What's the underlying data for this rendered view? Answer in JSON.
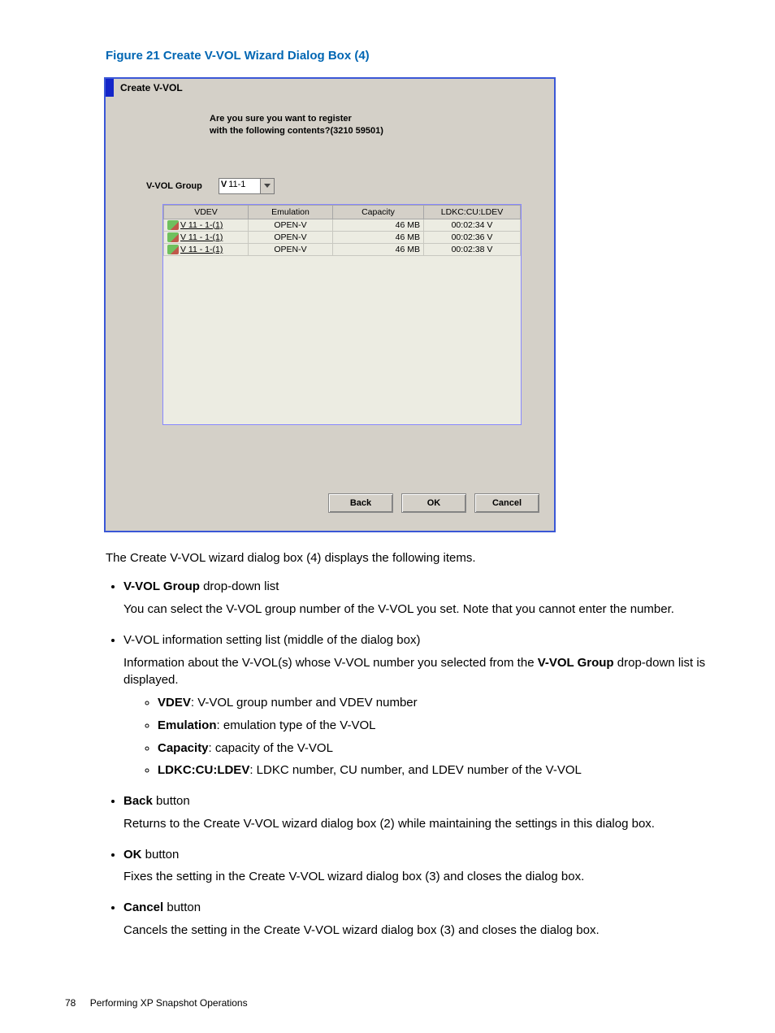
{
  "figure_caption": "Figure 21 Create V-VOL Wizard Dialog Box (4)",
  "dialog": {
    "title": "Create V-VOL",
    "prompt_line1": "Are you sure you want to register",
    "prompt_line2": "with the following contents?(3210 59501)",
    "group_label": "V-VOL Group",
    "group_prefix": "V",
    "group_value": "11-1",
    "table": {
      "headers": [
        "VDEV",
        "Emulation",
        "Capacity",
        "LDKC:CU:LDEV"
      ],
      "rows": [
        {
          "vdev": "V 11 - 1-(1)",
          "emulation": "OPEN-V",
          "capacity": "46 MB",
          "ldev": "00:02:34 V"
        },
        {
          "vdev": "V 11 - 1-(1)",
          "emulation": "OPEN-V",
          "capacity": "46 MB",
          "ldev": "00:02:36 V"
        },
        {
          "vdev": "V 11 - 1-(1)",
          "emulation": "OPEN-V",
          "capacity": "46 MB",
          "ldev": "00:02:38 V"
        }
      ]
    },
    "buttons": {
      "back": "Back",
      "ok": "OK",
      "cancel": "Cancel"
    }
  },
  "intro": "The Create V-VOL wizard dialog box (4) displays the following items.",
  "bullets": {
    "b1_head_bold": "V-VOL Group",
    "b1_head_rest": " drop-down list",
    "b1_body": "You can select the V-VOL group number of the V-VOL you set. Note that you cannot enter the number.",
    "b2_head": "V-VOL information setting list (middle of the dialog box)",
    "b2_body_pre": "Information about the V-VOL(s) whose V-VOL number you selected from the ",
    "b2_body_bold": "V-VOL Group",
    "b2_body_post": " drop-down list is displayed.",
    "b2_s1_b": "VDEV",
    "b2_s1_r": ": V-VOL group number and VDEV number",
    "b2_s2_b": "Emulation",
    "b2_s2_r": ": emulation type of the V-VOL",
    "b2_s3_b": "Capacity",
    "b2_s3_r": ": capacity of the V-VOL",
    "b2_s4_b": "LDKC:CU:LDEV",
    "b2_s4_r": ": LDKC number, CU number, and LDEV number of the V-VOL",
    "b3_head_bold": "Back",
    "b3_head_rest": " button",
    "b3_body": "Returns to the Create V-VOL wizard dialog box (2) while maintaining the settings in this dialog box.",
    "b4_head_bold": "OK",
    "b4_head_rest": " button",
    "b4_body": "Fixes the setting in the Create V-VOL wizard dialog box (3) and closes the dialog box.",
    "b5_head_bold": "Cancel",
    "b5_head_rest": " button",
    "b5_body": "Cancels the setting in the Create V-VOL wizard dialog box (3) and closes the dialog box."
  },
  "footer": {
    "page": "78",
    "section": "Performing XP Snapshot Operations"
  }
}
